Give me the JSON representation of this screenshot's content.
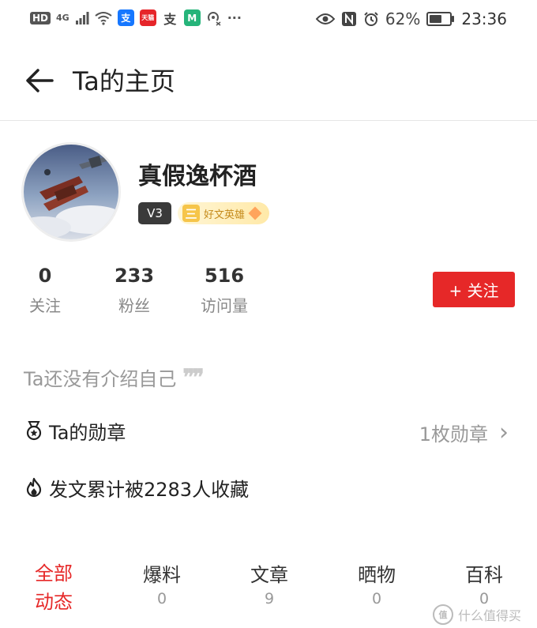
{
  "status_bar": {
    "hd": "HD",
    "network": "4G",
    "battery": "62%",
    "battery_level": 0.62,
    "time": "23:36",
    "app_icons": [
      {
        "name": "alipay-icon",
        "glyph": "支",
        "color": "#1677ff"
      },
      {
        "name": "tmall-icon",
        "glyph": "天猫",
        "color": "#e6252a"
      },
      {
        "name": "alipay-icon-2",
        "glyph": "支",
        "color": "#444444"
      },
      {
        "name": "mi-home-icon",
        "glyph": "M",
        "color": "#25b47a"
      }
    ],
    "more": "···"
  },
  "header": {
    "title": "Ta的主页"
  },
  "profile": {
    "username": "真假逸杯酒",
    "level": "V3",
    "honor_icon": "三",
    "honor": "好文英雄"
  },
  "stats": [
    {
      "value": "0",
      "label": "关注"
    },
    {
      "value": "233",
      "label": "粉丝"
    },
    {
      "value": "516",
      "label": "访问量"
    }
  ],
  "follow_button": "+ 关注",
  "intro": "Ta还没有介绍自己",
  "intro_quote": "❞❞",
  "medals": {
    "label": "Ta的勋章",
    "count": "1枚勋章",
    "chevron": "›"
  },
  "collection": {
    "text": "发文累计被2283人收藏"
  },
  "tabs": [
    {
      "label": "全部动态",
      "label_line1": "全部",
      "label_line2": "动态",
      "count": ""
    },
    {
      "label": "爆料",
      "count": "0"
    },
    {
      "label": "文章",
      "count": "9"
    },
    {
      "label": "晒物",
      "count": "0"
    },
    {
      "label": "百科",
      "count": "0"
    }
  ],
  "watermark": {
    "icon": "值",
    "text": "什么值得买"
  },
  "colors": {
    "accent": "#e62828",
    "level_badge": "#3a3a3a",
    "honor_text": "#c58a1b"
  }
}
